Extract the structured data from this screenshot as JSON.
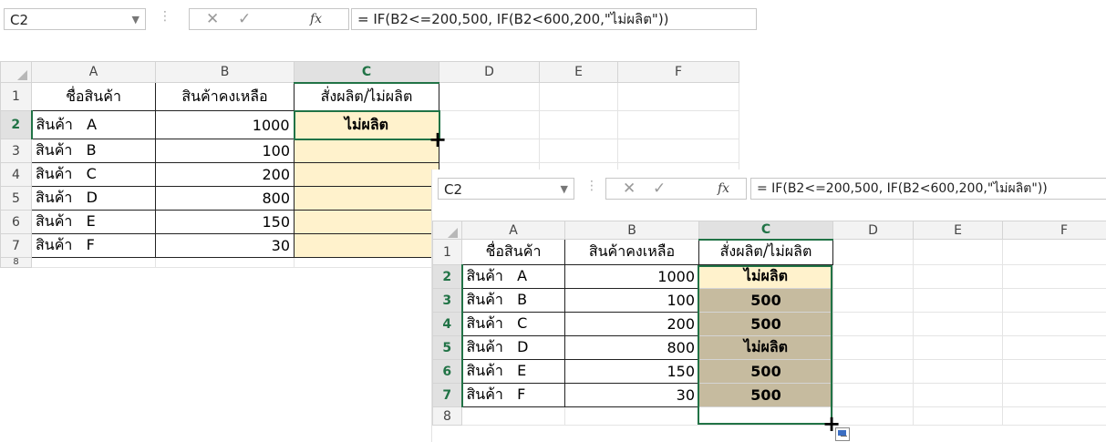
{
  "window_a": {
    "name_box": "C2",
    "formula": "= IF(B2<=200,500, IF(B2<600,200,\"ไม่ผลิต\"))",
    "columns": [
      "A",
      "B",
      "C",
      "D",
      "E",
      "F"
    ],
    "header_row": {
      "num": "1",
      "a": "ชื่อสินค้า",
      "b": "สินค้าคงเหลือ",
      "c": "สั่งผลิต/ไม่ผลิต"
    },
    "rows": [
      {
        "num": "2",
        "product": "สินค้า",
        "code": "A",
        "stock": "1000",
        "result": "ไม่ผลิต"
      },
      {
        "num": "3",
        "product": "สินค้า",
        "code": "B",
        "stock": "100",
        "result": ""
      },
      {
        "num": "4",
        "product": "สินค้า",
        "code": "C",
        "stock": "200",
        "result": ""
      },
      {
        "num": "5",
        "product": "สินค้า",
        "code": "D",
        "stock": "800",
        "result": ""
      },
      {
        "num": "6",
        "product": "สินค้า",
        "code": "E",
        "stock": "150",
        "result": ""
      },
      {
        "num": "7",
        "product": "สินค้า",
        "code": "F",
        "stock": "30",
        "result": ""
      }
    ],
    "cut_row": "8"
  },
  "window_b": {
    "name_box": "C2",
    "formula": "= IF(B2<=200,500, IF(B2<600,200,\"ไม่ผลิต\"))",
    "columns": [
      "A",
      "B",
      "C",
      "D",
      "E",
      "F"
    ],
    "header_row": {
      "num": "1",
      "a": "ชื่อสินค้า",
      "b": "สินค้าคงเหลือ",
      "c": "สั่งผลิต/ไม่ผลิต"
    },
    "rows": [
      {
        "num": "2",
        "product": "สินค้า",
        "code": "A",
        "stock": "1000",
        "result": "ไม่ผลิต"
      },
      {
        "num": "3",
        "product": "สินค้า",
        "code": "B",
        "stock": "100",
        "result": "500"
      },
      {
        "num": "4",
        "product": "สินค้า",
        "code": "C",
        "stock": "200",
        "result": "500"
      },
      {
        "num": "5",
        "product": "สินค้า",
        "code": "D",
        "stock": "800",
        "result": "ไม่ผลิต"
      },
      {
        "num": "6",
        "product": "สินค้า",
        "code": "E",
        "stock": "150",
        "result": "500"
      },
      {
        "num": "7",
        "product": "สินค้า",
        "code": "F",
        "stock": "30",
        "result": "500"
      }
    ],
    "cut_row": "8"
  },
  "icons": {
    "dropdown": "chevron-down-icon",
    "cancel": "cancel-x-icon",
    "enter": "checkmark-icon",
    "function": "fx-icon",
    "fill_handle": "crosshair-cursor-icon",
    "autofill_options": "autofill-options-icon"
  },
  "colors": {
    "selection_green": "#217346",
    "pale_fill": "#fff2cc",
    "tan_fill": "#c6bb9f"
  }
}
